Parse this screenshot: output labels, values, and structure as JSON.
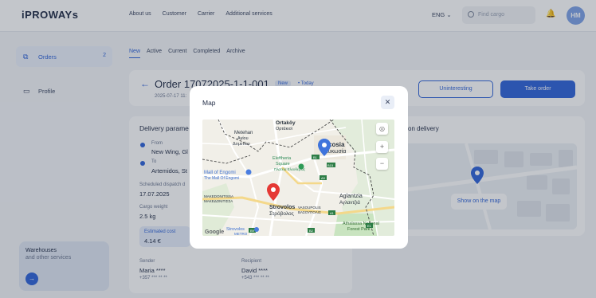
{
  "header": {
    "logo": "iPROWAYs",
    "nav": [
      "About us",
      "Customer",
      "Carrier",
      "Additional services"
    ],
    "lang": "ENG",
    "search_placeholder": "Find cargo",
    "avatar": "HM"
  },
  "sidebar": {
    "orders_label": "Orders",
    "orders_count": "2",
    "profile_label": "Profile",
    "promo_title": "Warehouses",
    "promo_sub": "and other services"
  },
  "tabs": [
    "New",
    "Active",
    "Current",
    "Completed",
    "Archive"
  ],
  "order": {
    "title": "Order 17072025-1-1-001",
    "status": "New",
    "status2": "• Today",
    "date": "2025-07-17 11:",
    "btn_uninteresting": "Uninteresting",
    "btn_take": "Take order"
  },
  "delivery": {
    "title": "Delivery parame",
    "from_label": "From",
    "from_value": "New Wing, Gl",
    "to_label": "To",
    "to_value": "Artemidos, St",
    "dispatch_label": "Scheduled dispatch d",
    "dispatch_value": "17.07.2025",
    "weight_label": "Cargo weight",
    "weight_value": "2.5 kg",
    "cost_label": "Estimated cost",
    "cost_value": "4.14 €",
    "sender_label": "Sender",
    "sender_value": "Maria ****",
    "sender_phone": "+357 *** ** **",
    "recipient_label": "Recipient",
    "recipient_value": "David ****",
    "recipient_phone": "+543 *** ** **"
  },
  "map_card": {
    "title": "on delivery",
    "show_button": "Show on the map"
  },
  "modal": {
    "title": "Map",
    "close": "✕",
    "map_labels": {
      "ortakoy": "Ortaköy",
      "ortakoy_gr": "Ορτάκιοϊ",
      "metehan": "Metehan",
      "agios": "Αγίου",
      "dometiou": "Δομετίου",
      "nicosia": "Nicosia",
      "lefkosia": "Λευκωσία",
      "eleftheria": "Eleftheria",
      "square": "Square",
      "eleftheria_gr": "Πλατεία Ελευθερίας",
      "mall": "Mall of Engomi",
      "mall_gr": "The Mall Of Engomi",
      "strovolos": "Strovolos",
      "strovolos_gr": "Στρόβολος",
      "aglantzia": "Aglantzia",
      "aglantzia_gr": "Αγλαντζιά",
      "makedonitissa": "MAKEDONITISSA",
      "makedonitissa_gr": "ΜΑΚΕΔΟΝΙΤΙΣΣΑ",
      "vasoupolis": "VASOUPOLIS",
      "vasoupolis_gr": "ΒΑΣΟΥΠΟΛΙΣ",
      "athalassa": "Athalassa National",
      "forest": "Forest Park",
      "metro": "METRO",
      "strovolos_store": "Strovolos",
      "google": "Google",
      "b1": "B1",
      "b15": "B15",
      "a9": "A9",
      "a1": "A1",
      "b2": "B2",
      "b9": "B9",
      "e1": "E1"
    }
  }
}
